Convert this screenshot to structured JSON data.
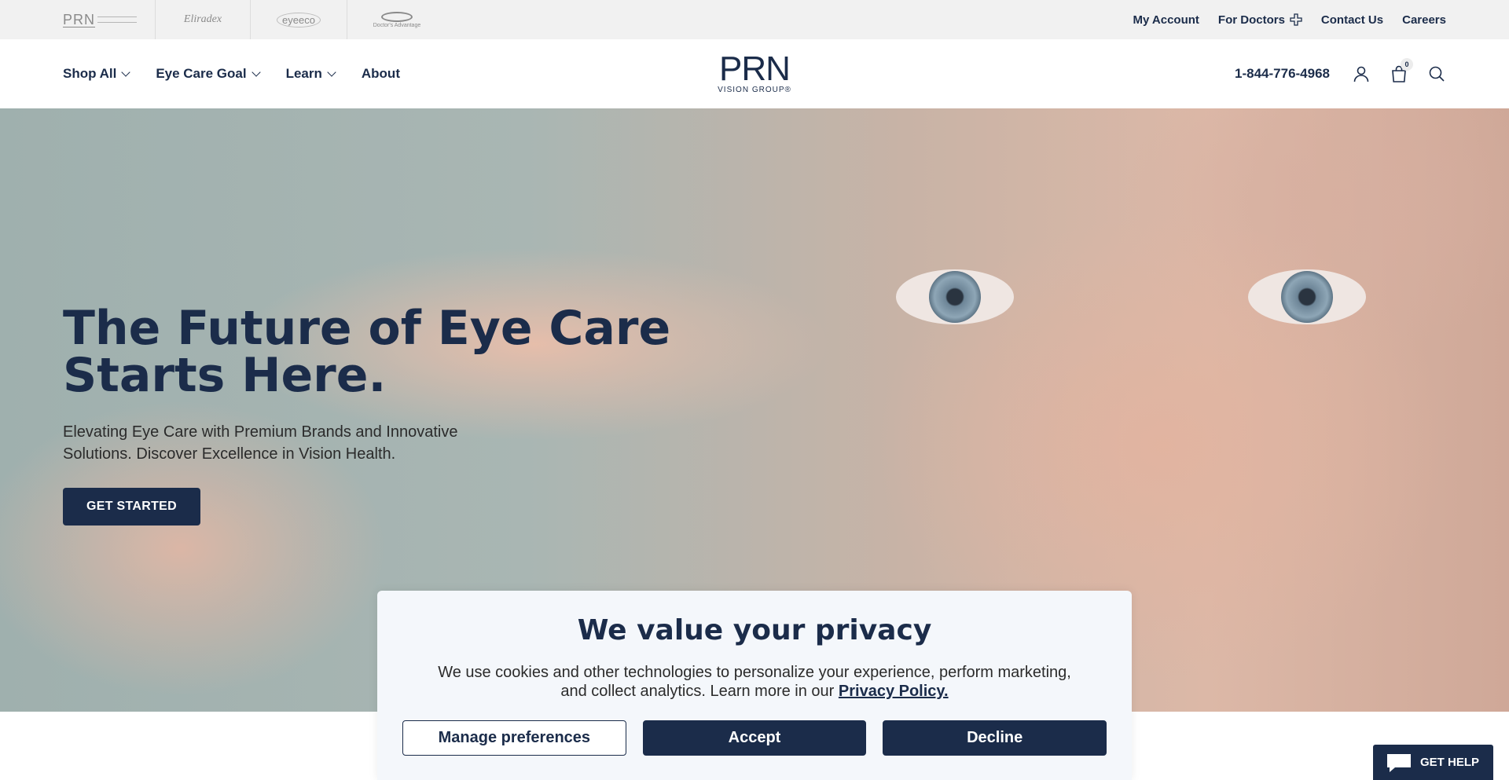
{
  "top_bar": {
    "brands": [
      {
        "name": "PRN",
        "icon": "prn-brand-logo"
      },
      {
        "name": "Eliradex",
        "icon": "eliradex-brand-logo"
      },
      {
        "name": "eyeeco",
        "icon": "eyeeco-brand-logo"
      },
      {
        "name": "Doctor's Advantage",
        "icon": "doctors-advantage-brand-logo"
      }
    ],
    "links": {
      "my_account": "My Account",
      "for_doctors": "For Doctors",
      "contact_us": "Contact Us",
      "careers": "Careers"
    }
  },
  "header": {
    "nav": {
      "shop_all": "Shop All",
      "eye_care_goal": "Eye Care Goal",
      "learn": "Learn",
      "about": "About"
    },
    "logo": {
      "main": "PRN",
      "sub": "VISION GROUP®"
    },
    "phone": "1-844-776-4968",
    "cart_count": "0"
  },
  "hero": {
    "title": "The Future of Eye Care Starts Here.",
    "subtitle": "Elevating Eye Care with Premium Brands and Innovative Solutions. Discover Excellence in Vision Health.",
    "cta_label": "GET STARTED"
  },
  "cookie_banner": {
    "title": "We value your privacy",
    "text": "We use cookies and other technologies to personalize your experience, perform marketing, and collect analytics. Learn more in our ",
    "link_text": "Privacy Policy.",
    "buttons": {
      "manage": "Manage preferences",
      "accept": "Accept",
      "decline": "Decline"
    }
  },
  "help_widget": {
    "label": "GET HELP"
  },
  "colors": {
    "brand_navy": "#1b2c4a",
    "top_bar_bg": "#f1f1f1",
    "banner_bg": "#f4f7fb"
  }
}
